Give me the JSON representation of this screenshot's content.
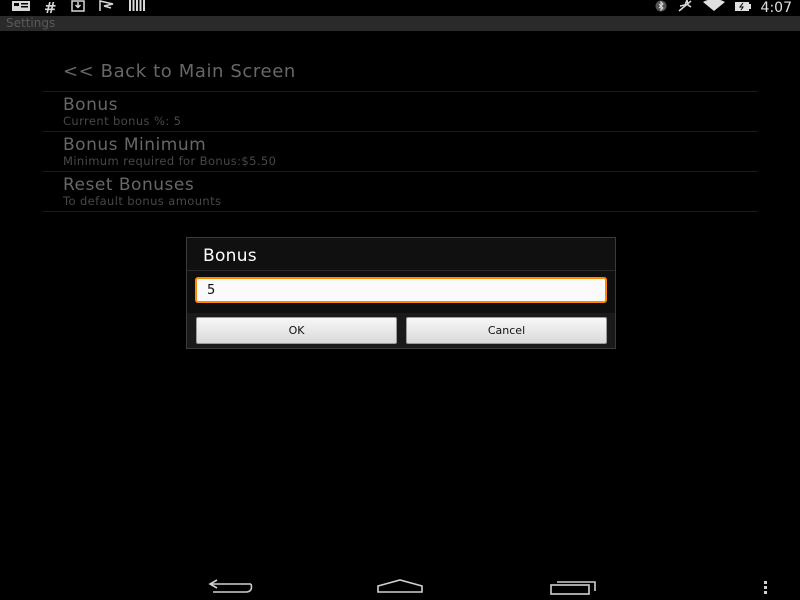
{
  "status_bar": {
    "time": "4:07",
    "left_icons": [
      "notification-card-icon",
      "hash-icon",
      "download-icon",
      "flag-icon",
      "barcode-icon"
    ],
    "right_icons": [
      "bluetooth-icon",
      "airplane-mode-icon",
      "wifi-icon",
      "battery-icon"
    ]
  },
  "title_bar": {
    "title": "Settings"
  },
  "preferences": {
    "back_label": "<< Back to Main Screen",
    "items": [
      {
        "title": "Bonus",
        "summary": "Current bonus %: 5"
      },
      {
        "title": "Bonus Minimum",
        "summary": "Minimum required for Bonus:$5.50"
      },
      {
        "title": "Reset Bonuses",
        "summary": "To default bonus amounts"
      }
    ]
  },
  "dialog": {
    "title": "Bonus",
    "input_value": "5",
    "ok_label": "OK",
    "cancel_label": "Cancel"
  },
  "nav_bar": {
    "icons": [
      "back-icon",
      "home-icon",
      "recent-apps-icon",
      "overflow-menu-icon"
    ]
  },
  "colors": {
    "accent": "#ff8a00",
    "background": "#000000",
    "text_muted": "#7a7a7a"
  }
}
